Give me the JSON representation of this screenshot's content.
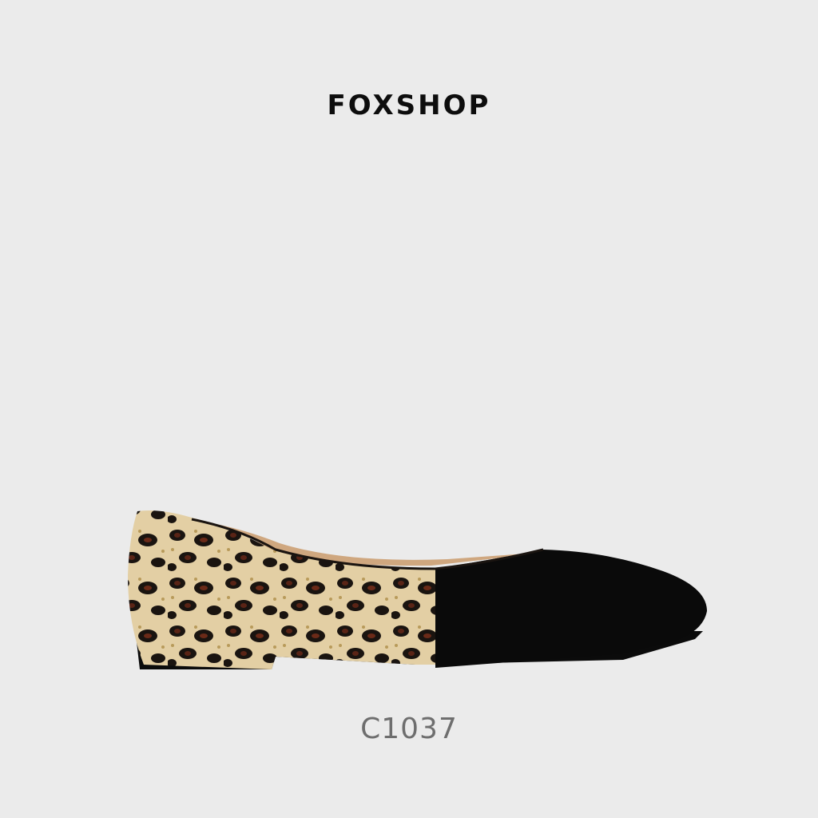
{
  "brand": {
    "name": "FOXSHOP"
  },
  "product": {
    "code": "C1037",
    "image_icon": "leopard-print-flat-shoe",
    "colors": {
      "background": "#ebebeb",
      "upper_black": "#0a0a0a",
      "leopard_base": "#e3cfa4",
      "leopard_spot": "#1a1410",
      "leopard_brown": "#5a2416",
      "lining": "#cfa77f"
    }
  }
}
